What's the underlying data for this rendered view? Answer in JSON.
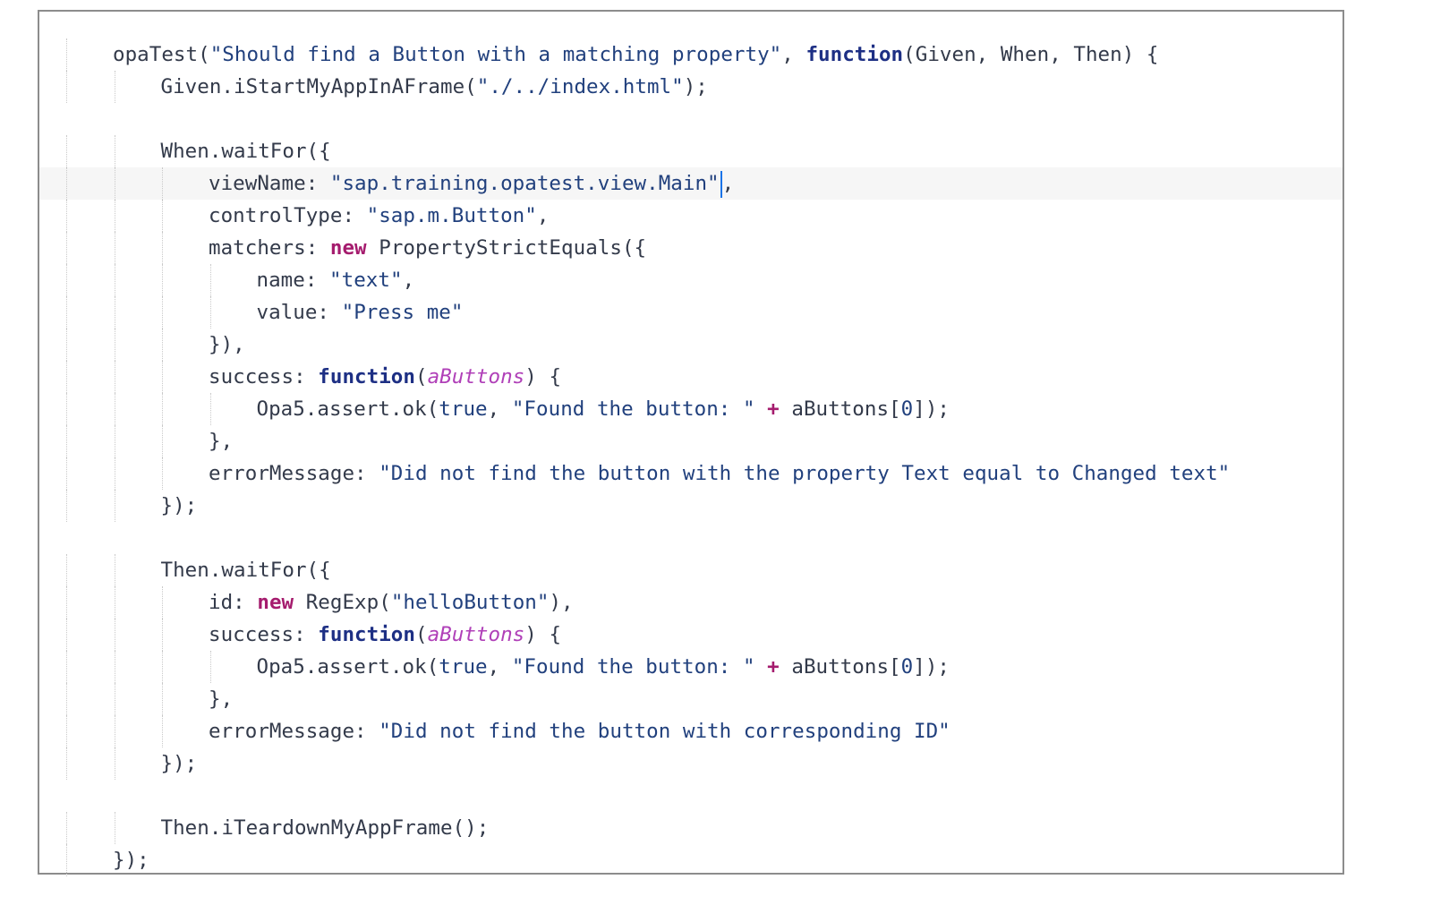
{
  "editor": {
    "colors": {
      "plain": "#333a4a",
      "string": "#21407d",
      "keyword": "#1d2f84",
      "new_keyword": "#a51c6e",
      "parameter": "#b040b8",
      "caret": "#1a73e8",
      "current_line": "#f6f6f6"
    },
    "lines": [
      {
        "indent": 0,
        "tokens": [
          {
            "t": "opaTest(",
            "c": "plain"
          },
          {
            "t": "\"Should find a Button with a matching property\"",
            "c": "str"
          },
          {
            "t": ", ",
            "c": "plain"
          },
          {
            "t": "function",
            "c": "kw"
          },
          {
            "t": "(Given, When, Then) {",
            "c": "plain"
          }
        ]
      },
      {
        "indent": 1,
        "tokens": [
          {
            "t": "Given.iStartMyAppInAFrame(",
            "c": "plain"
          },
          {
            "t": "\"./../index.html\"",
            "c": "str"
          },
          {
            "t": ");",
            "c": "plain"
          }
        ]
      },
      {
        "indent": 0,
        "tokens": []
      },
      {
        "indent": 1,
        "tokens": [
          {
            "t": "When.waitFor({",
            "c": "plain"
          }
        ]
      },
      {
        "indent": 2,
        "highlight": true,
        "caret": true,
        "tokens": [
          {
            "t": "viewName: ",
            "c": "plain"
          },
          {
            "t": "\"sap.training.opatest.view.Main\"",
            "c": "str"
          },
          {
            "t": ",",
            "c": "plain"
          }
        ]
      },
      {
        "indent": 2,
        "tokens": [
          {
            "t": "controlType: ",
            "c": "plain"
          },
          {
            "t": "\"sap.m.Button\"",
            "c": "str"
          },
          {
            "t": ",",
            "c": "plain"
          }
        ]
      },
      {
        "indent": 2,
        "tokens": [
          {
            "t": "matchers: ",
            "c": "plain"
          },
          {
            "t": "new",
            "c": "new"
          },
          {
            "t": " PropertyStrictEquals({",
            "c": "plain"
          }
        ]
      },
      {
        "indent": 3,
        "tokens": [
          {
            "t": "name: ",
            "c": "plain"
          },
          {
            "t": "\"text\"",
            "c": "str"
          },
          {
            "t": ",",
            "c": "plain"
          }
        ]
      },
      {
        "indent": 3,
        "tokens": [
          {
            "t": "value: ",
            "c": "plain"
          },
          {
            "t": "\"Press me\"",
            "c": "str"
          }
        ]
      },
      {
        "indent": 2,
        "tokens": [
          {
            "t": "}),",
            "c": "plain"
          }
        ]
      },
      {
        "indent": 2,
        "tokens": [
          {
            "t": "success: ",
            "c": "plain"
          },
          {
            "t": "function",
            "c": "kw"
          },
          {
            "t": "(",
            "c": "plain"
          },
          {
            "t": "aButtons",
            "c": "param"
          },
          {
            "t": ") {",
            "c": "plain"
          }
        ]
      },
      {
        "indent": 3,
        "tokens": [
          {
            "t": "Opa5.assert.ok(",
            "c": "plain"
          },
          {
            "t": "true",
            "c": "str"
          },
          {
            "t": ", ",
            "c": "plain"
          },
          {
            "t": "\"Found the button: \"",
            "c": "str"
          },
          {
            "t": " ",
            "c": "plain"
          },
          {
            "t": "+",
            "c": "op"
          },
          {
            "t": " aButtons[",
            "c": "plain"
          },
          {
            "t": "0",
            "c": "str"
          },
          {
            "t": "]);",
            "c": "plain"
          }
        ]
      },
      {
        "indent": 2,
        "tokens": [
          {
            "t": "},",
            "c": "plain"
          }
        ]
      },
      {
        "indent": 2,
        "tokens": [
          {
            "t": "errorMessage: ",
            "c": "plain"
          },
          {
            "t": "\"Did not find the button with the property Text equal to Changed text\"",
            "c": "str"
          }
        ]
      },
      {
        "indent": 1,
        "tokens": [
          {
            "t": "});",
            "c": "plain"
          }
        ]
      },
      {
        "indent": 0,
        "tokens": []
      },
      {
        "indent": 1,
        "tokens": [
          {
            "t": "Then.waitFor({",
            "c": "plain"
          }
        ]
      },
      {
        "indent": 2,
        "tokens": [
          {
            "t": "id: ",
            "c": "plain"
          },
          {
            "t": "new",
            "c": "new"
          },
          {
            "t": " RegExp(",
            "c": "plain"
          },
          {
            "t": "\"helloButton\"",
            "c": "str"
          },
          {
            "t": "),",
            "c": "plain"
          }
        ]
      },
      {
        "indent": 2,
        "tokens": [
          {
            "t": "success: ",
            "c": "plain"
          },
          {
            "t": "function",
            "c": "kw"
          },
          {
            "t": "(",
            "c": "plain"
          },
          {
            "t": "aButtons",
            "c": "param"
          },
          {
            "t": ") {",
            "c": "plain"
          }
        ]
      },
      {
        "indent": 3,
        "tokens": [
          {
            "t": "Opa5.assert.ok(",
            "c": "plain"
          },
          {
            "t": "true",
            "c": "str"
          },
          {
            "t": ", ",
            "c": "plain"
          },
          {
            "t": "\"Found the button: \"",
            "c": "str"
          },
          {
            "t": " ",
            "c": "plain"
          },
          {
            "t": "+",
            "c": "op"
          },
          {
            "t": " aButtons[",
            "c": "plain"
          },
          {
            "t": "0",
            "c": "str"
          },
          {
            "t": "]);",
            "c": "plain"
          }
        ]
      },
      {
        "indent": 2,
        "tokens": [
          {
            "t": "},",
            "c": "plain"
          }
        ]
      },
      {
        "indent": 2,
        "tokens": [
          {
            "t": "errorMessage: ",
            "c": "plain"
          },
          {
            "t": "\"Did not find the button with corresponding ID\"",
            "c": "str"
          }
        ]
      },
      {
        "indent": 1,
        "tokens": [
          {
            "t": "});",
            "c": "plain"
          }
        ]
      },
      {
        "indent": 0,
        "tokens": []
      },
      {
        "indent": 1,
        "tokens": [
          {
            "t": "Then.iTeardownMyAppFrame();",
            "c": "plain"
          }
        ]
      },
      {
        "indent": 0,
        "tokens": [
          {
            "t": "});",
            "c": "plain"
          }
        ]
      }
    ]
  }
}
